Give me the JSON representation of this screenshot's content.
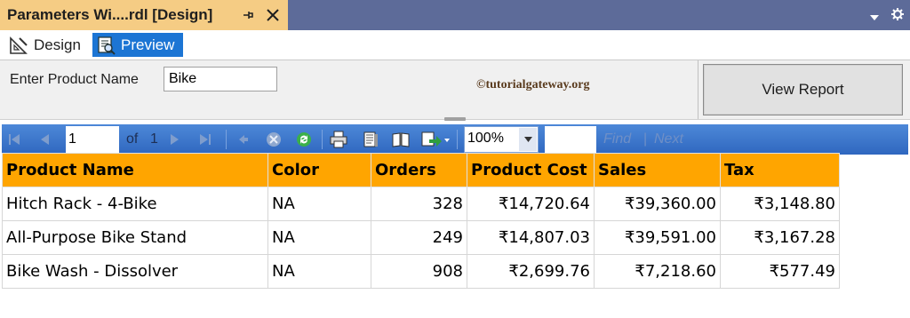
{
  "window": {
    "tab_title": "Parameters Wi....rdl [Design]",
    "pin_glyph": "⊣"
  },
  "modes": {
    "design_label": "Design",
    "preview_label": "Preview"
  },
  "params": {
    "product_label": "Enter Product Name",
    "product_value": "Bike",
    "watermark": "©tutorialgateway.org",
    "view_report_label": "View Report"
  },
  "toolbar": {
    "page_value": "1",
    "of_label": "of",
    "total_pages": "1",
    "zoom_value": "100%",
    "find_label": "Find",
    "find_separator": "|",
    "next_label": "Next"
  },
  "table": {
    "headers": [
      "Product Name",
      "Color",
      "Orders",
      "Product Cost",
      "Sales",
      "Tax"
    ],
    "rows": [
      [
        "Hitch Rack - 4-Bike",
        "NA",
        "328",
        "₹14,720.64",
        "₹39,360.00",
        "₹3,148.80"
      ],
      [
        "All-Purpose Bike Stand",
        "NA",
        "249",
        "₹14,807.03",
        "₹39,591.00",
        "₹3,167.28"
      ],
      [
        "Bike Wash - Dissolver",
        "NA",
        "908",
        "₹2,699.76",
        "₹7,218.60",
        "₹577.49"
      ]
    ]
  },
  "colors": {
    "title_bar": "#5d6b99",
    "active_tab": "#f5cc84",
    "preview_selected": "#1c75d4",
    "toolbar": "#3a73c9",
    "header_fill": "#ffa500"
  }
}
